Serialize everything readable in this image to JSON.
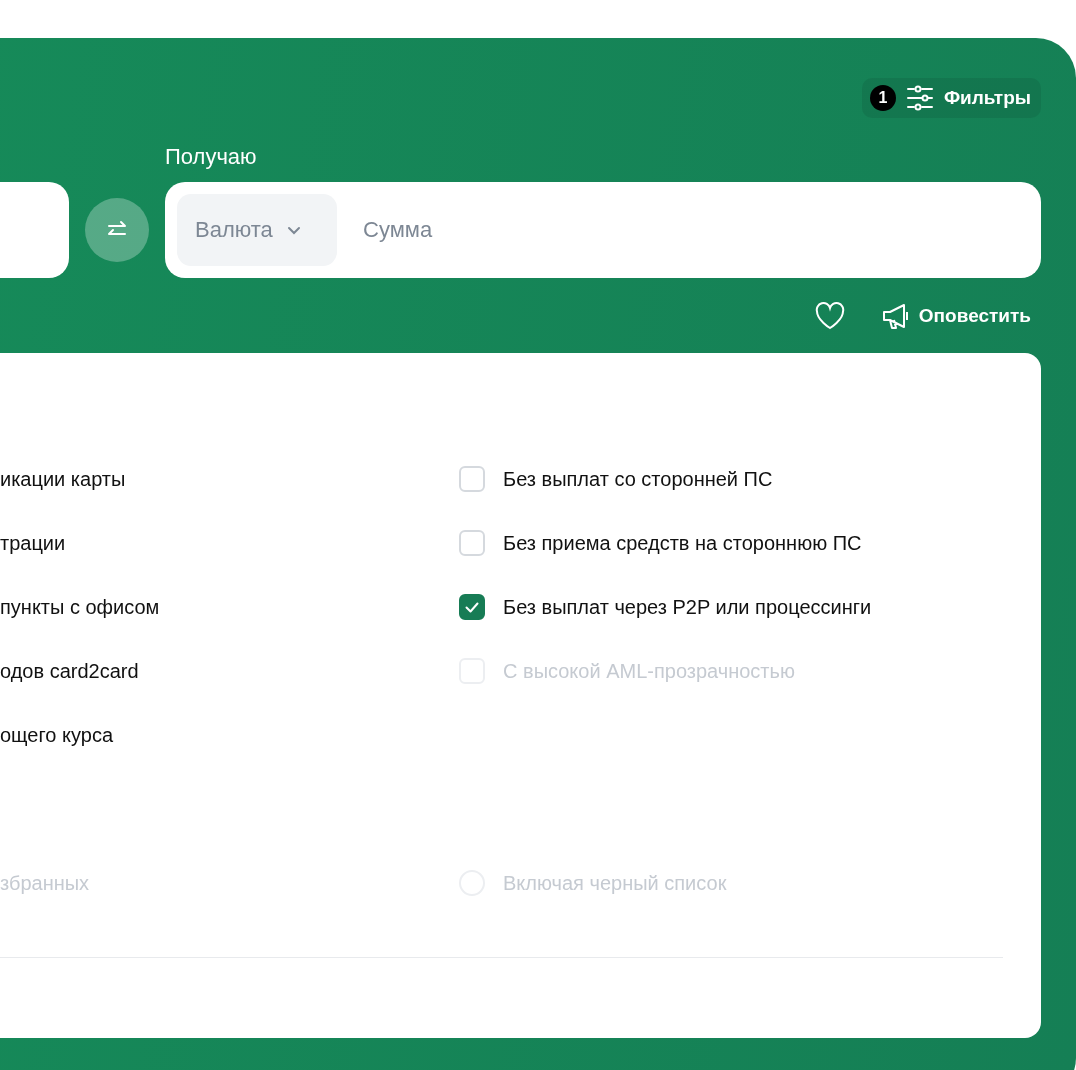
{
  "filters_button": {
    "badge": "1",
    "label": "Фильтры"
  },
  "exchange": {
    "receive_label": "Получаю",
    "currency_select": {
      "placeholder": "Валюта"
    },
    "amount_field": {
      "placeholder": "Сумма"
    }
  },
  "actions": {
    "notify_label": "Оповестить"
  },
  "options_left": [
    {
      "label": "икации карты",
      "disabled": false
    },
    {
      "label": "трации",
      "disabled": false
    },
    {
      "label": "пункты с офисом",
      "disabled": false
    },
    {
      "label": "одов card2card",
      "disabled": false
    },
    {
      "label": "ощего курса",
      "disabled": false
    }
  ],
  "options_right": [
    {
      "label": "Без выплат со сторонней ПС",
      "checked": false,
      "disabled": false
    },
    {
      "label": "Без приема средств на стороннюю ПС",
      "checked": false,
      "disabled": false
    },
    {
      "label": "Без выплат через P2P или процессинги",
      "checked": true,
      "disabled": false
    },
    {
      "label": "С высокой AML-прозрачностью",
      "checked": false,
      "disabled": true
    }
  ],
  "extra_left": {
    "label": "збранных",
    "disabled": true
  },
  "extra_right": {
    "label": "Включая черный список",
    "checked": false,
    "disabled": true
  }
}
